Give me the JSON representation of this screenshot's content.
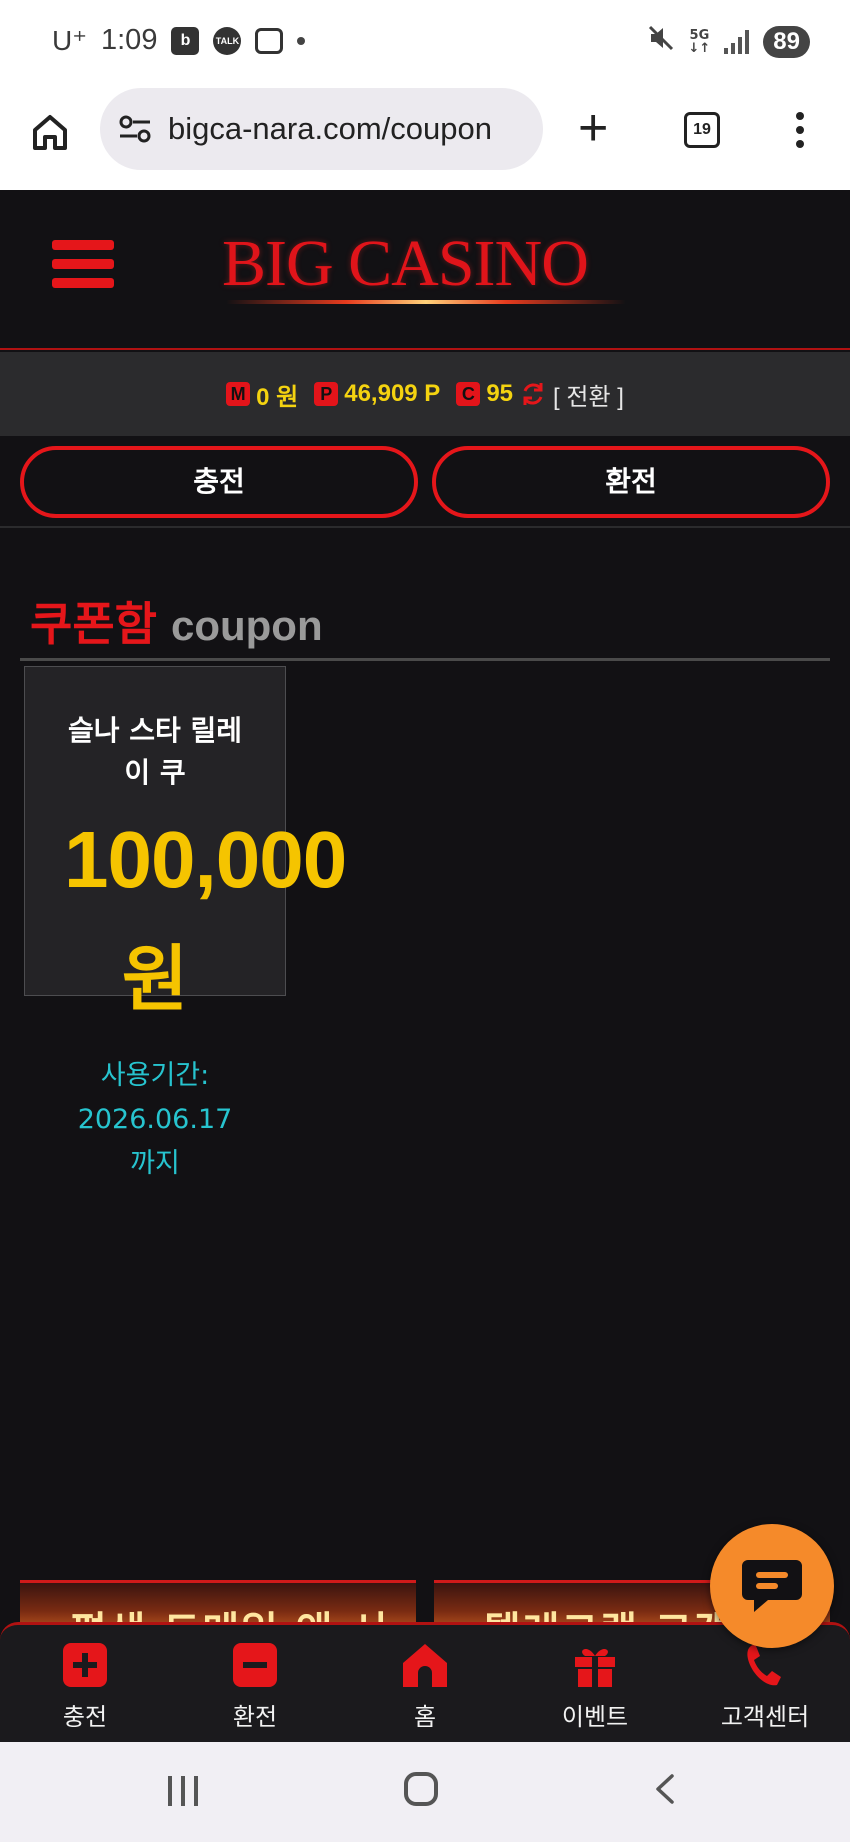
{
  "status_bar": {
    "carrier": "U⁺",
    "time": "1:09",
    "network": "5G",
    "battery": "89"
  },
  "browser": {
    "url": "bigca-nara.com/coupon",
    "tab_count": "19"
  },
  "site": {
    "logo": "BIG CASINO"
  },
  "balance": {
    "money_badge": "M",
    "money": "0 원",
    "point_badge": "P",
    "points": "46,909 P",
    "comp_badge": "C",
    "comp": "95",
    "switch_label": "[ 전환 ]"
  },
  "actions": {
    "charge_label": "충전",
    "exchange_label": "환전"
  },
  "section": {
    "title_ko": "쿠폰함",
    "title_en": "coupon"
  },
  "coupon": {
    "name_line1": "슬나 스타 릴레",
    "name_line2": "이 쿠",
    "amount": "100,000",
    "unit": "원",
    "expiry_label": "사용기간:",
    "expiry_date": "2026.06.17",
    "expiry_suffix": "까지"
  },
  "bottom_nav": {
    "items": [
      {
        "label": "충전",
        "icon": "plus-icon"
      },
      {
        "label": "환전",
        "icon": "minus-icon"
      },
      {
        "label": "홈",
        "icon": "home-icon"
      },
      {
        "label": "이벤트",
        "icon": "gift-icon"
      },
      {
        "label": "고객센터",
        "icon": "phone-icon"
      }
    ]
  },
  "colors": {
    "brand_red": "#e5161a",
    "gold": "#f5c400",
    "cyan": "#27c4cf",
    "chat_orange": "#f58a2a"
  }
}
